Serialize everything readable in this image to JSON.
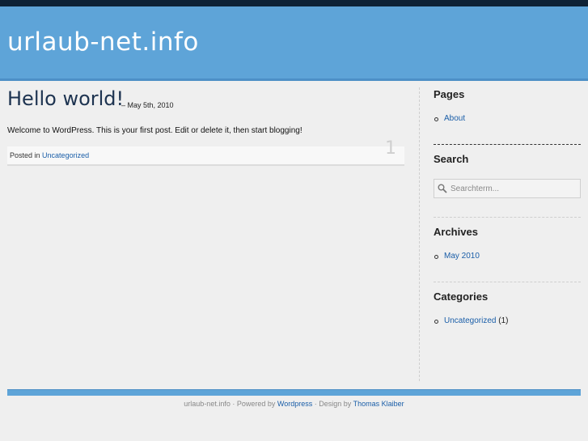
{
  "header": {
    "site_title": "urlaub-net.info"
  },
  "post": {
    "title": "Hello world!",
    "date": "– May 5th, 2010",
    "body": "Welcome to WordPress. This is your first post. Edit or delete it, then start blogging!",
    "posted_in_label": "Posted in",
    "category": "Uncategorized",
    "comment_count": "1"
  },
  "sidebar": {
    "pages": {
      "title": "Pages",
      "items": [
        "About"
      ]
    },
    "search": {
      "title": "Search",
      "placeholder": "Searchterm..."
    },
    "archives": {
      "title": "Archives",
      "items": [
        "May 2010"
      ]
    },
    "categories": {
      "title": "Categories",
      "items": [
        {
          "name": "Uncategorized",
          "count": "(1)"
        }
      ]
    }
  },
  "footer": {
    "site": "urlaub-net.info",
    "powered_by_label": "· Powered by",
    "wordpress_link": "Wordpress",
    "design_by_label": "· Design by",
    "designer_link": "Thomas Klaiber"
  },
  "colors": {
    "header_bg": "#5ea4d8",
    "top_bar": "#0e2236",
    "link": "#1a5ea8",
    "title": "#1d3350"
  }
}
